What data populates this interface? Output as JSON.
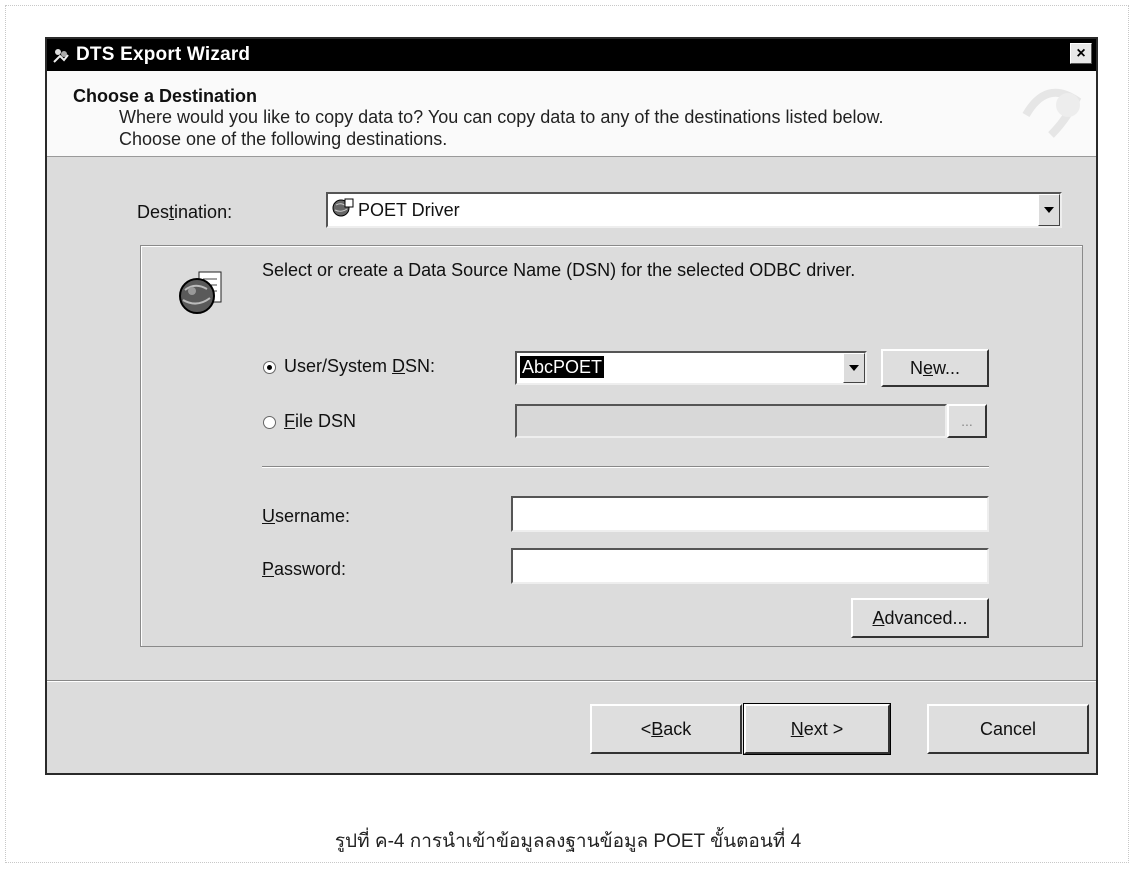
{
  "window": {
    "title": "DTS Export Wizard",
    "close_label": "×"
  },
  "header": {
    "title": "Choose a Destination",
    "description_line1": "Where would you like to copy data to? You can copy data to any of the destinations listed below.",
    "description_line2": "Choose one of the following destinations."
  },
  "destination": {
    "label_pre": "Des",
    "label_mnemonic": "t",
    "label_post": "ination:",
    "selected_value": "POET Driver"
  },
  "dsn_panel": {
    "instruction": "Select or create a Data Source Name (DSN) for the selected ODBC driver.",
    "user_system_dsn": {
      "label_pre": "User/System ",
      "label_mnemonic": "D",
      "label_post": "SN:",
      "selected": true,
      "value": "AbcPOET"
    },
    "file_dsn": {
      "label_mnemonic": "F",
      "label_post": "ile DSN",
      "selected": false,
      "value": ""
    },
    "new_button": {
      "pre": "N",
      "mnemonic": "e",
      "post": "w..."
    },
    "browse_button": "...",
    "username": {
      "label_mnemonic": "U",
      "label_post": "sername:",
      "value": ""
    },
    "password": {
      "label_mnemonic": "P",
      "label_post": "assword:",
      "value": ""
    },
    "advanced_button": {
      "mnemonic": "A",
      "post": "dvanced..."
    }
  },
  "footer": {
    "back_button": {
      "pre": "< ",
      "mnemonic": "B",
      "post": "ack"
    },
    "next_button": {
      "mnemonic": "N",
      "post": "ext >"
    },
    "cancel_button": "Cancel"
  },
  "caption": "รูปที่ ค-4 การนำเข้าข้อมูลลงฐานข้อมูล POET ขั้นตอนที่ 4",
  "colors": {
    "titlebar": "#000000",
    "dialog_bg": "#dcdcdc",
    "header_bg": "#fafafa",
    "selection_bg": "#000000"
  }
}
